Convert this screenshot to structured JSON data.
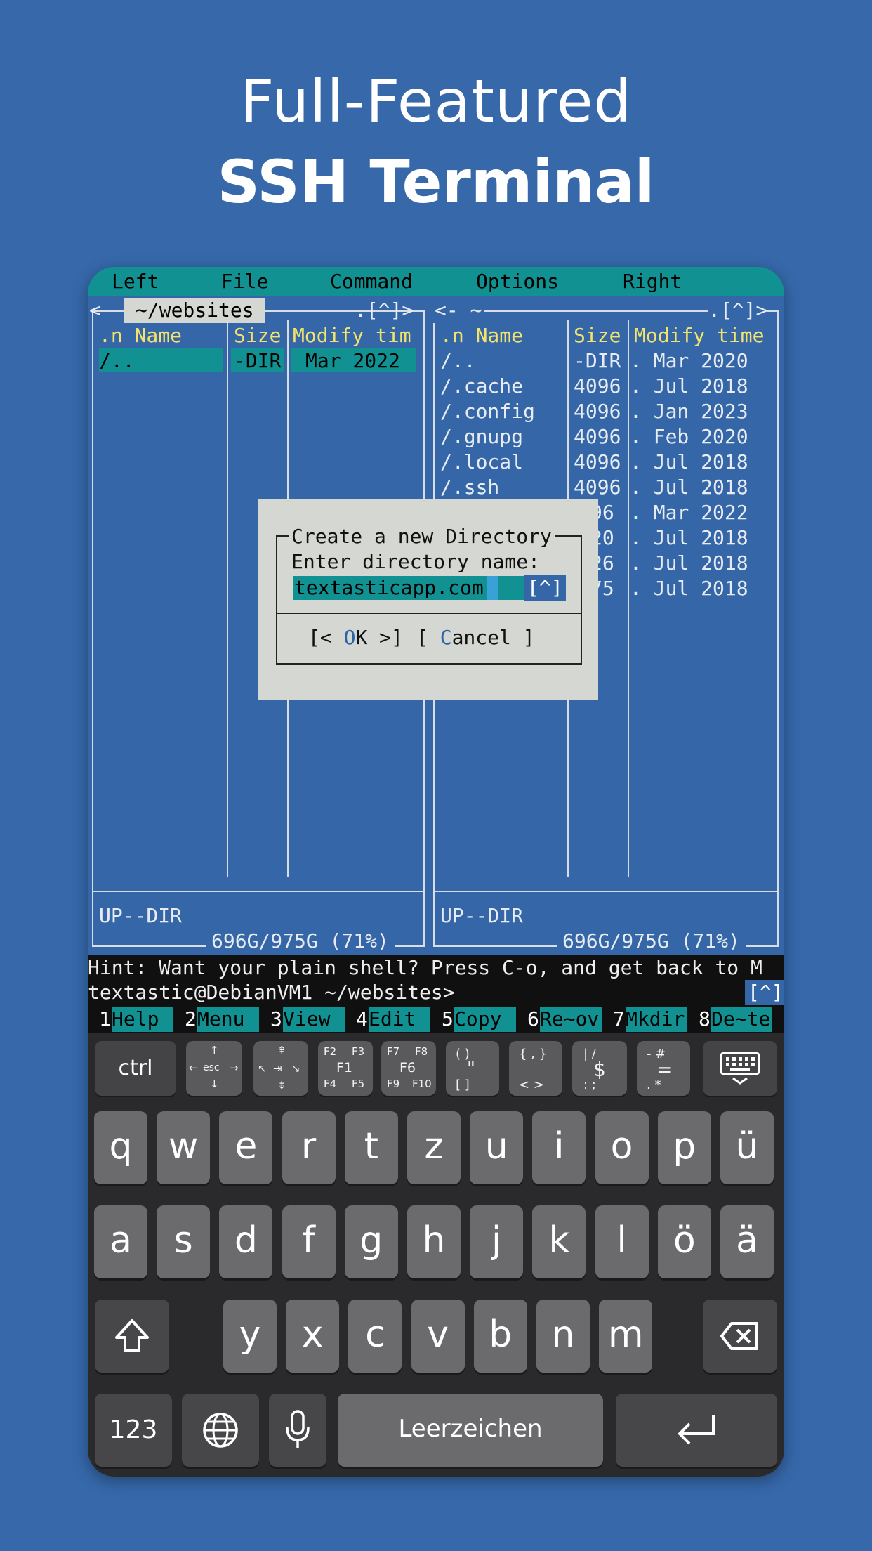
{
  "headline": {
    "line1": "Full-Featured",
    "line2": "SSH Terminal"
  },
  "menubar": {
    "left": "Left",
    "file": "File",
    "command": "Command",
    "options": "Options",
    "right": "Right"
  },
  "left_panel": {
    "path": "~/websites",
    "arrows": "<",
    "top_right": ".[^]>",
    "header": {
      "name": ".n Name",
      "size": "Size",
      "time": "Modify tim"
    },
    "rows": [
      {
        "name": "/..",
        "size": "-DIR",
        "time": "Mar 2022"
      }
    ],
    "status": "UP--DIR",
    "disk": "696G/975G (71%)"
  },
  "right_panel": {
    "path": "<- ~",
    "top_right": ".[^]>",
    "header": {
      "name": ".n Name",
      "size": "Size",
      "time": "Modify time"
    },
    "rows": [
      {
        "name": "/..",
        "size": "-DIR",
        "time": ". Mar 2020"
      },
      {
        "name": "/.cache",
        "size": "4096",
        "time": ". Jul 2018"
      },
      {
        "name": "/.config",
        "size": "4096",
        "time": ". Jan 2023"
      },
      {
        "name": "/.gnupg",
        "size": "4096",
        "time": ". Feb 2020"
      },
      {
        "name": "/.local",
        "size": "4096",
        "time": ". Jul 2018"
      },
      {
        "name": "/.ssh",
        "size": "4096",
        "time": ". Jul 2018"
      },
      {
        "name": "",
        "size": "96",
        "time": ". Mar 2022"
      },
      {
        "name": "",
        "size": "20",
        "time": ". Jul 2018"
      },
      {
        "name": "",
        "size": "26",
        "time": ". Jul 2018"
      },
      {
        "name": "",
        "size": "75",
        "time": ". Jul 2018"
      }
    ],
    "status": "UP--DIR",
    "disk": "696G/975G (71%)"
  },
  "dialog": {
    "title": "Create a new Directory",
    "prompt": "Enter directory name:",
    "value": "textasticapp.com",
    "history": "[^]",
    "ok_pre": "[< ",
    "ok_hot": "O",
    "ok_post": "K >]",
    "cancel_pre": "[ ",
    "cancel_hot": "C",
    "cancel_post": "ancel ]"
  },
  "hint": "Hint: Want your plain shell? Press C-o, and get back to M",
  "prompt": "textastic@DebianVM1 ~/websites>",
  "prompt_history": "[^]",
  "fkeys": [
    {
      "num": "1",
      "label": "Help"
    },
    {
      "num": "2",
      "label": "Menu"
    },
    {
      "num": "3",
      "label": "View"
    },
    {
      "num": "4",
      "label": "Edit"
    },
    {
      "num": "5",
      "label": "Copy"
    },
    {
      "num": "6",
      "label": "Re~ov"
    },
    {
      "num": "7",
      "label": "Mkdir"
    },
    {
      "num": "8",
      "label": "De~te"
    }
  ],
  "special_keys": {
    "ctrl": "ctrl",
    "esc": "esc",
    "f1": "F1",
    "f2": "F2",
    "f3": "F3",
    "f4": "F4",
    "f5": "F5",
    "f6": "F6",
    "f7": "F7",
    "f8": "F8",
    "f9": "F9",
    "f10": "F10"
  },
  "keyboard": {
    "row1": [
      "q",
      "w",
      "e",
      "r",
      "t",
      "z",
      "u",
      "i",
      "o",
      "p",
      "ü"
    ],
    "row2": [
      "a",
      "s",
      "d",
      "f",
      "g",
      "h",
      "j",
      "k",
      "l",
      "ö",
      "ä"
    ],
    "row3": [
      "y",
      "x",
      "c",
      "v",
      "b",
      "n",
      "m"
    ],
    "numbers": "123",
    "space": "Leerzeichen"
  },
  "colors": {
    "background": "#3668aa",
    "terminal_bg": "#3567a8",
    "cyan": "#119191",
    "yellow": "#f3e36d",
    "dialog_bg": "#d5d8d2"
  }
}
